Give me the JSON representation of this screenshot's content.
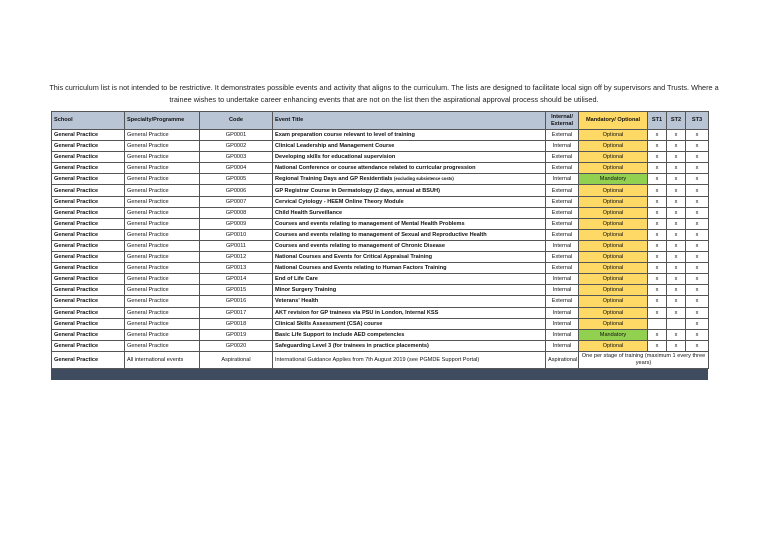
{
  "intro": "This curriculum list is not intended to be restrictive. It demonstrates possible events and activity that aligns to the curriculum. The lists are designed to facilitate local sign off by supervisors and Trusts. Where a trainee wishes to undertake career enhancing events that are not on the list then the aspirational approval process should be utilised.",
  "headers": {
    "school": "School",
    "specialty": "Specialty/Programme",
    "code": "Code",
    "title": "Event Title",
    "int_ext": "Internal/ External",
    "mand_opt": "Mandatory/ Optional",
    "st1": "ST1",
    "st2": "ST2",
    "st3": "ST3"
  },
  "colors": {
    "optional": "#ffd966",
    "mandatory": "#92d050",
    "header": "#b9c4d4",
    "footer_bar": "#3f4c60"
  },
  "rows": [
    {
      "school": "General Practice",
      "specialty": "General Practice",
      "code": "GP0001",
      "title": "Exam preparation course relevant to level of training",
      "note": "",
      "int_ext": "External",
      "mand_opt": "Optional",
      "st1": "x",
      "st2": "x",
      "st3": "x"
    },
    {
      "school": "General Practice",
      "specialty": "General Practice",
      "code": "GP0002",
      "title": "Clinical Leadership and Management Course",
      "note": "",
      "int_ext": "Internal",
      "mand_opt": "Optional",
      "st1": "x",
      "st2": "x",
      "st3": "x"
    },
    {
      "school": "General Practice",
      "specialty": "General Practice",
      "code": "GP0003",
      "title": "Developing skills for educational supervision",
      "note": "",
      "int_ext": "External",
      "mand_opt": "Optional",
      "st1": "x",
      "st2": "x",
      "st3": "x"
    },
    {
      "school": "General Practice",
      "specialty": "General Practice",
      "code": "GP0004",
      "title": "National Conference or course attendance related to curricular progression",
      "note": "",
      "int_ext": "External",
      "mand_opt": "Optional",
      "st1": "x",
      "st2": "x",
      "st3": "x"
    },
    {
      "school": "General Practice",
      "specialty": "General Practice",
      "code": "GP0005",
      "title": "Regional Training Days and GP Residentials",
      "note": "(excluding subsistence costs)",
      "int_ext": "Internal",
      "mand_opt": "Mandatory",
      "st1": "x",
      "st2": "x",
      "st3": "x"
    },
    {
      "school": "General Practice",
      "specialty": "General Practice",
      "code": "GP0006",
      "title": "GP Registrar Course in Dermatology (2 days, annual at BSUH)",
      "note": "",
      "int_ext": "External",
      "mand_opt": "Optional",
      "st1": "x",
      "st2": "x",
      "st3": "x"
    },
    {
      "school": "General Practice",
      "specialty": "General Practice",
      "code": "GP0007",
      "title": "Cervical Cytology - HEEM Online Theory Module",
      "note": "",
      "int_ext": "External",
      "mand_opt": "Optional",
      "st1": "x",
      "st2": "x",
      "st3": "x"
    },
    {
      "school": "General Practice",
      "specialty": "General Practice",
      "code": "GP0008",
      "title": "Child Health Surveillance",
      "note": "",
      "int_ext": "External",
      "mand_opt": "Optional",
      "st1": "x",
      "st2": "x",
      "st3": "x"
    },
    {
      "school": "General Practice",
      "specialty": "General Practice",
      "code": "GP0009",
      "title": "Courses and events relating to management of Mental Health Problems",
      "note": "",
      "int_ext": "External",
      "mand_opt": "Optional",
      "st1": "x",
      "st2": "x",
      "st3": "x"
    },
    {
      "school": "General Practice",
      "specialty": "General Practice",
      "code": "GP0010",
      "title": "Courses and events relating to management of Sexual and Reproductive Health",
      "note": "",
      "int_ext": "External",
      "mand_opt": "Optional",
      "st1": "x",
      "st2": "x",
      "st3": "x"
    },
    {
      "school": "General Practice",
      "specialty": "General Practice",
      "code": "GP0011",
      "title": "Courses and events relating to management of Chronic Disease",
      "note": "",
      "int_ext": "Internal",
      "mand_opt": "Optional",
      "st1": "x",
      "st2": "x",
      "st3": "x"
    },
    {
      "school": "General Practice",
      "specialty": "General Practice",
      "code": "GP0012",
      "title": "National Courses and Events for Critical Appraisal Training",
      "note": "",
      "int_ext": "External",
      "mand_opt": "Optional",
      "st1": "x",
      "st2": "x",
      "st3": "x"
    },
    {
      "school": "General Practice",
      "specialty": "General Practice",
      "code": "GP0013",
      "title": "National Courses and Events relating to Human Factors Training",
      "note": "",
      "int_ext": "External",
      "mand_opt": "Optional",
      "st1": "x",
      "st2": "x",
      "st3": "x"
    },
    {
      "school": "General Practice",
      "specialty": "General Practice",
      "code": "GP0014",
      "title": "End of Life Care",
      "note": "",
      "int_ext": "Internal",
      "mand_opt": "Optional",
      "st1": "x",
      "st2": "x",
      "st3": "x"
    },
    {
      "school": "General Practice",
      "specialty": "General Practice",
      "code": "GP0015",
      "title": "Minor Surgery Training",
      "note": "",
      "int_ext": "Internal",
      "mand_opt": "Optional",
      "st1": "x",
      "st2": "x",
      "st3": "x"
    },
    {
      "school": "General Practice",
      "specialty": "General Practice",
      "code": "GP0016",
      "title": "Veterans' Health",
      "note": "",
      "int_ext": "External",
      "mand_opt": "Optional",
      "st1": "x",
      "st2": "x",
      "st3": "x"
    },
    {
      "school": "General Practice",
      "specialty": "General Practice",
      "code": "GP0017",
      "title": "AKT revision for GP trainees via PSU in London, Internal KSS",
      "note": "",
      "int_ext": "Internal",
      "mand_opt": "Optional",
      "st1": "x",
      "st2": "x",
      "st3": "x"
    },
    {
      "school": "General Practice",
      "specialty": "General Practice",
      "code": "GP0018",
      "title": "Clinical Skills Assessment  (CSA)  course",
      "note": "",
      "int_ext": "Internal",
      "mand_opt": "Optional",
      "st1": "",
      "st2": "",
      "st3": "x"
    },
    {
      "school": "General Practice",
      "specialty": "General Practice",
      "code": "GP0019",
      "title": "Basic Life Support to include AED competencies",
      "note": "",
      "int_ext": "Internal",
      "mand_opt": "Mandatory",
      "st1": "x",
      "st2": "x",
      "st3": "x"
    },
    {
      "school": "General Practice",
      "specialty": "General Practice",
      "code": "GP0020",
      "title": "Safeguarding Level 3 (for trainees in practice placements)",
      "note": "",
      "int_ext": "Internal",
      "mand_opt": "Optional",
      "st1": "x",
      "st2": "x",
      "st3": "x"
    }
  ],
  "last_row": {
    "school": "General Practice",
    "specialty": "All international events",
    "code": "Aspirational",
    "title": "International Guidance Applies from 7th August 2019 (see PGMDE Support Portal)",
    "int_ext": "Aspirational",
    "stages": "One per stage of training (maximum 1 every three years)"
  }
}
